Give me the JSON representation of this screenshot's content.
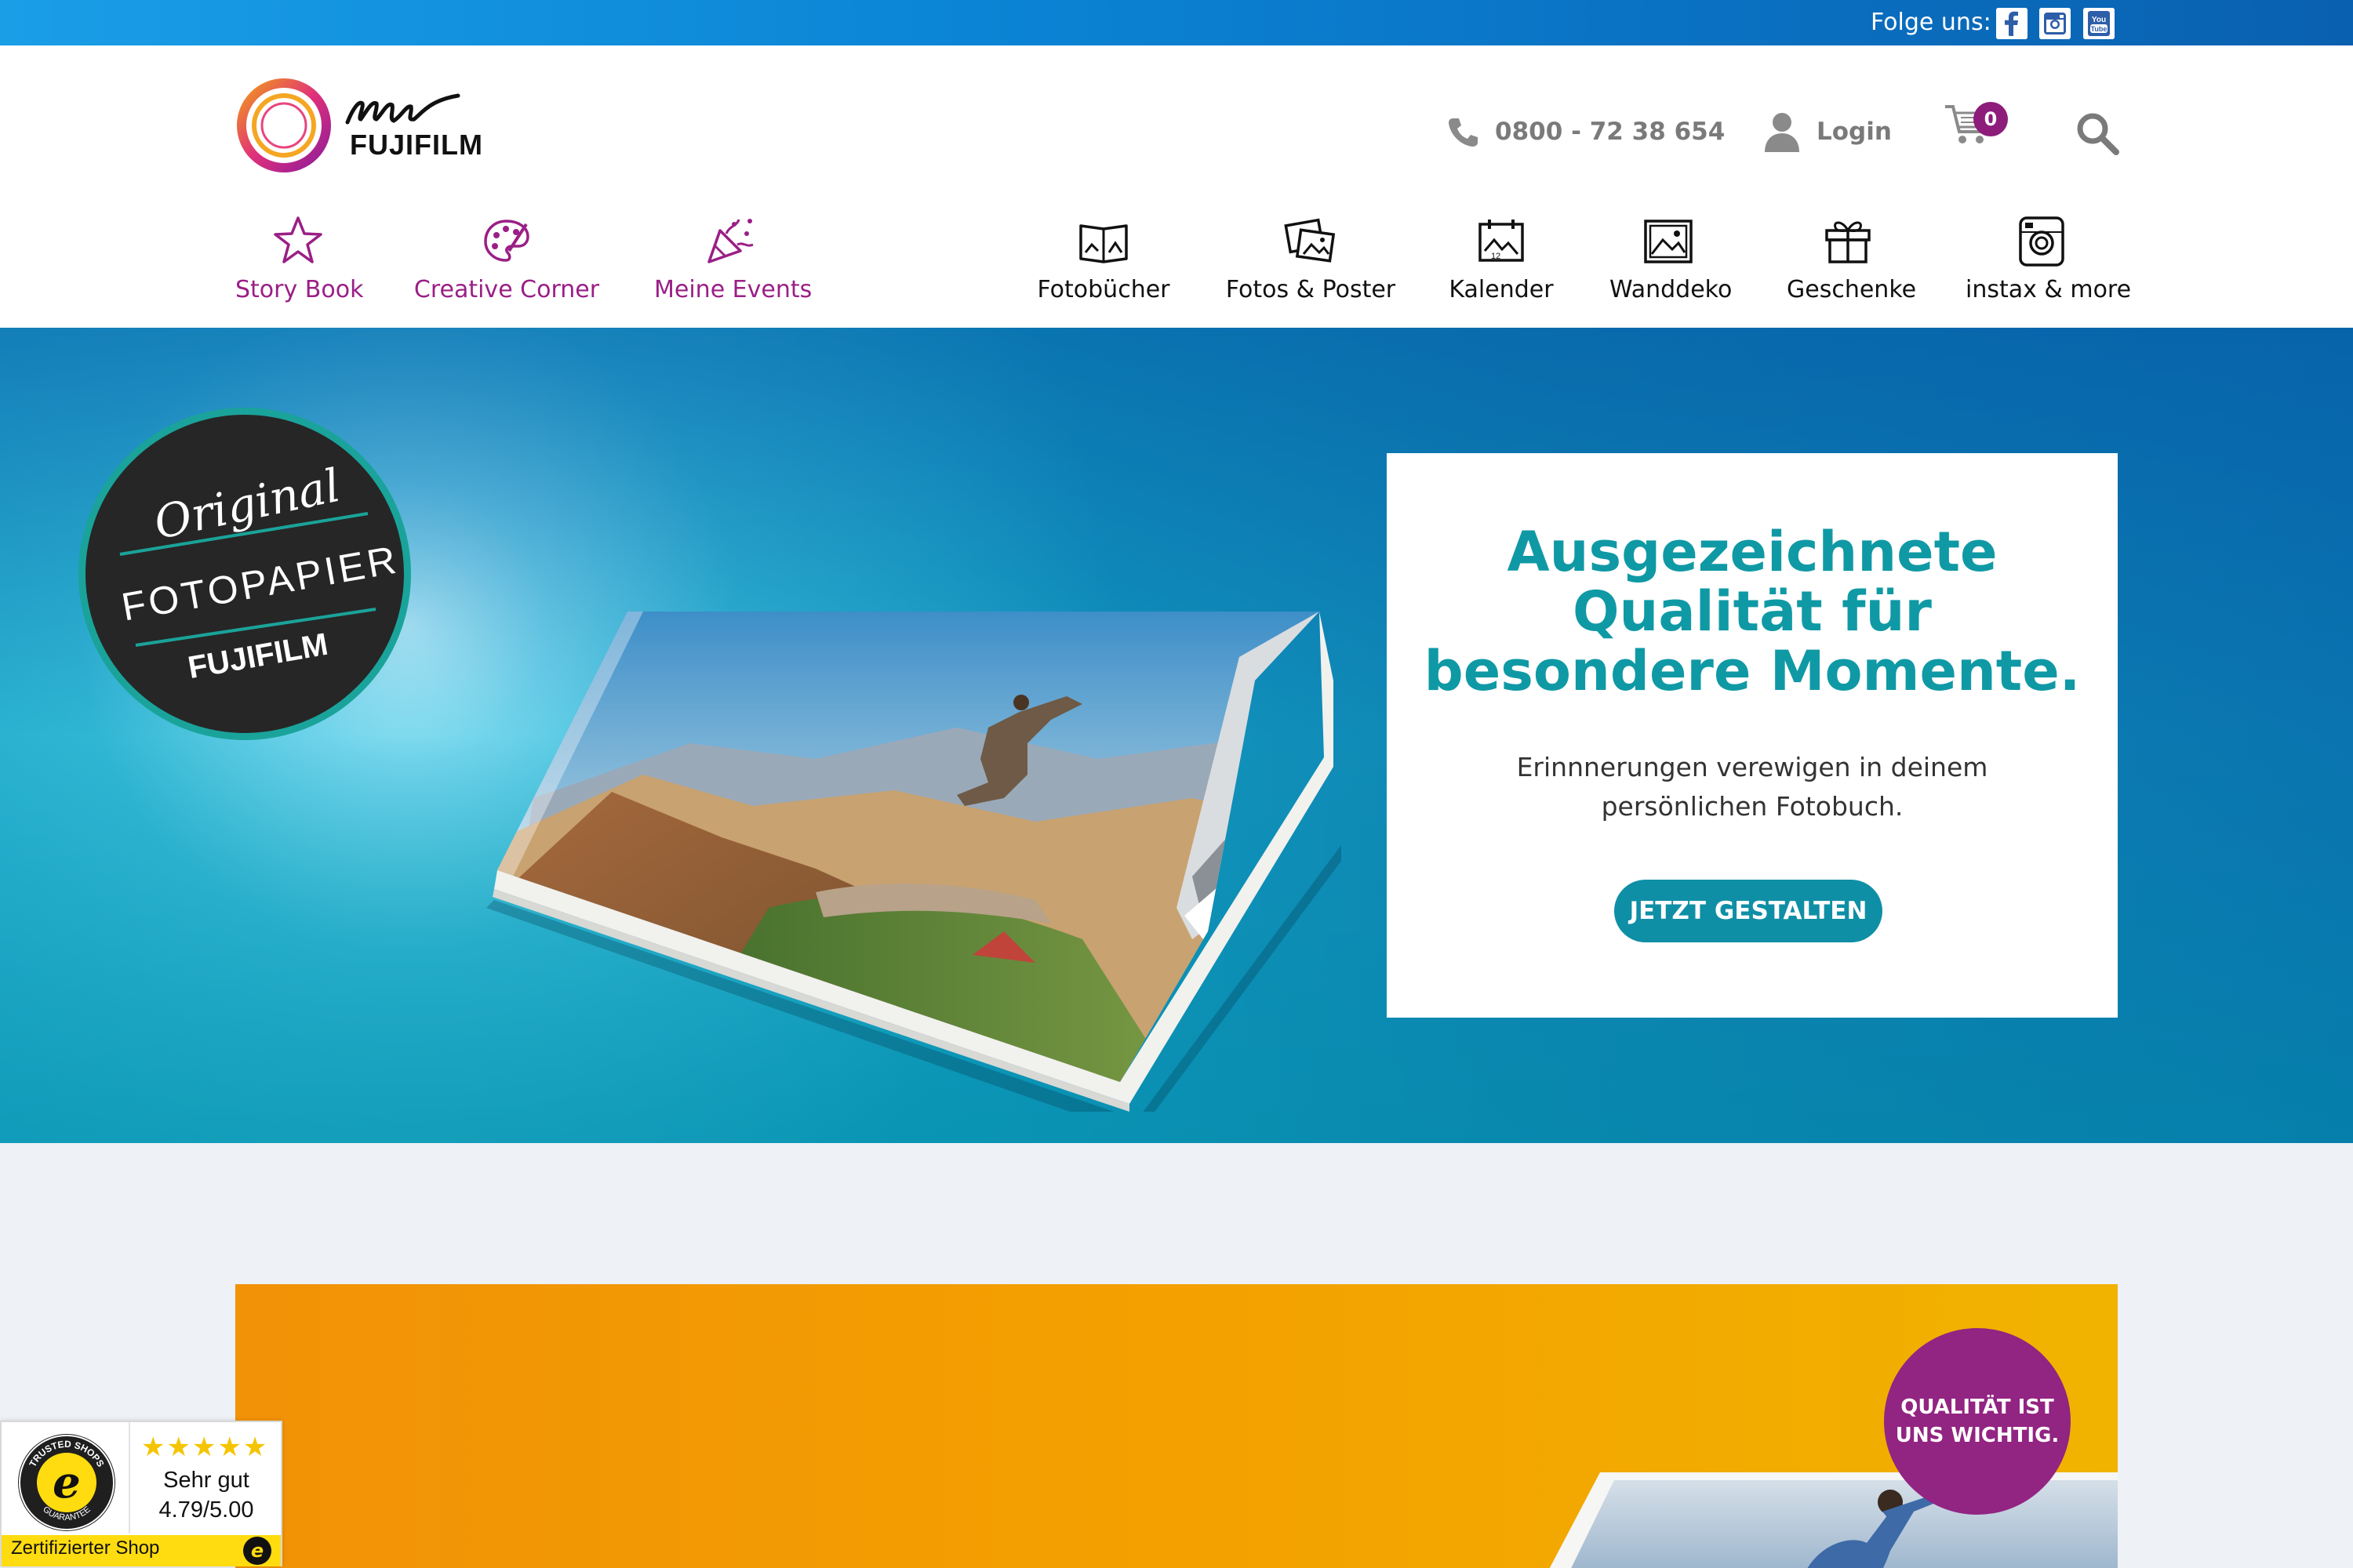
{
  "topbar": {
    "follow_label": "Folge uns:",
    "social": [
      {
        "icon": "facebook-icon"
      },
      {
        "icon": "instagram-icon"
      },
      {
        "icon": "youtube-icon"
      }
    ]
  },
  "header": {
    "logo": {
      "script": "my",
      "wordmark": "FUJIFILM"
    },
    "phone": "0800 - 72 38 654",
    "login": "Login",
    "cart_count": "0",
    "nav_left": [
      {
        "label": "Story Book",
        "icon": "star-icon"
      },
      {
        "label": "Creative Corner",
        "icon": "palette-icon"
      },
      {
        "label": "Meine Events",
        "icon": "party-popper-icon"
      }
    ],
    "nav_right": [
      {
        "label": "Fotobücher",
        "icon": "photo-book-icon"
      },
      {
        "label": "Fotos & Poster",
        "icon": "photos-icon"
      },
      {
        "label": "Kalender",
        "icon": "calendar-icon"
      },
      {
        "label": "Wanddeko",
        "icon": "wall-picture-icon"
      },
      {
        "label": "Geschenke",
        "icon": "gift-icon"
      },
      {
        "label": "instax & more",
        "icon": "instant-camera-icon"
      }
    ]
  },
  "hero": {
    "badge": {
      "line1": "Original",
      "line2": "FOTOPAPIER",
      "line3": "FUJIFILM"
    },
    "title": "Ausgezeichnete Qualität für besondere Momente.",
    "subtitle": "Erinnnerungen verewigen in deinem persönlichen Fotobuch.",
    "cta": "JETZT GESTALTEN"
  },
  "promo": {
    "badge_line1": "QUALITÄT IST",
    "badge_line2": "UNS WICHTIG."
  },
  "trust_widget": {
    "stars": "★★★★★",
    "rating_text": "Sehr gut",
    "score": "4.79/5.00",
    "certified": "Zertifizierter Shop",
    "seal_top": "TRUSTED SHOPS",
    "seal_bottom": "GUARANTEE"
  },
  "colors": {
    "accent_purple": "#9a1f86",
    "accent_teal": "#0f99a5",
    "cta_teal": "#0f8fa6",
    "promo_orange": "#f3a000",
    "trust_yellow": "#ffdc0f"
  }
}
